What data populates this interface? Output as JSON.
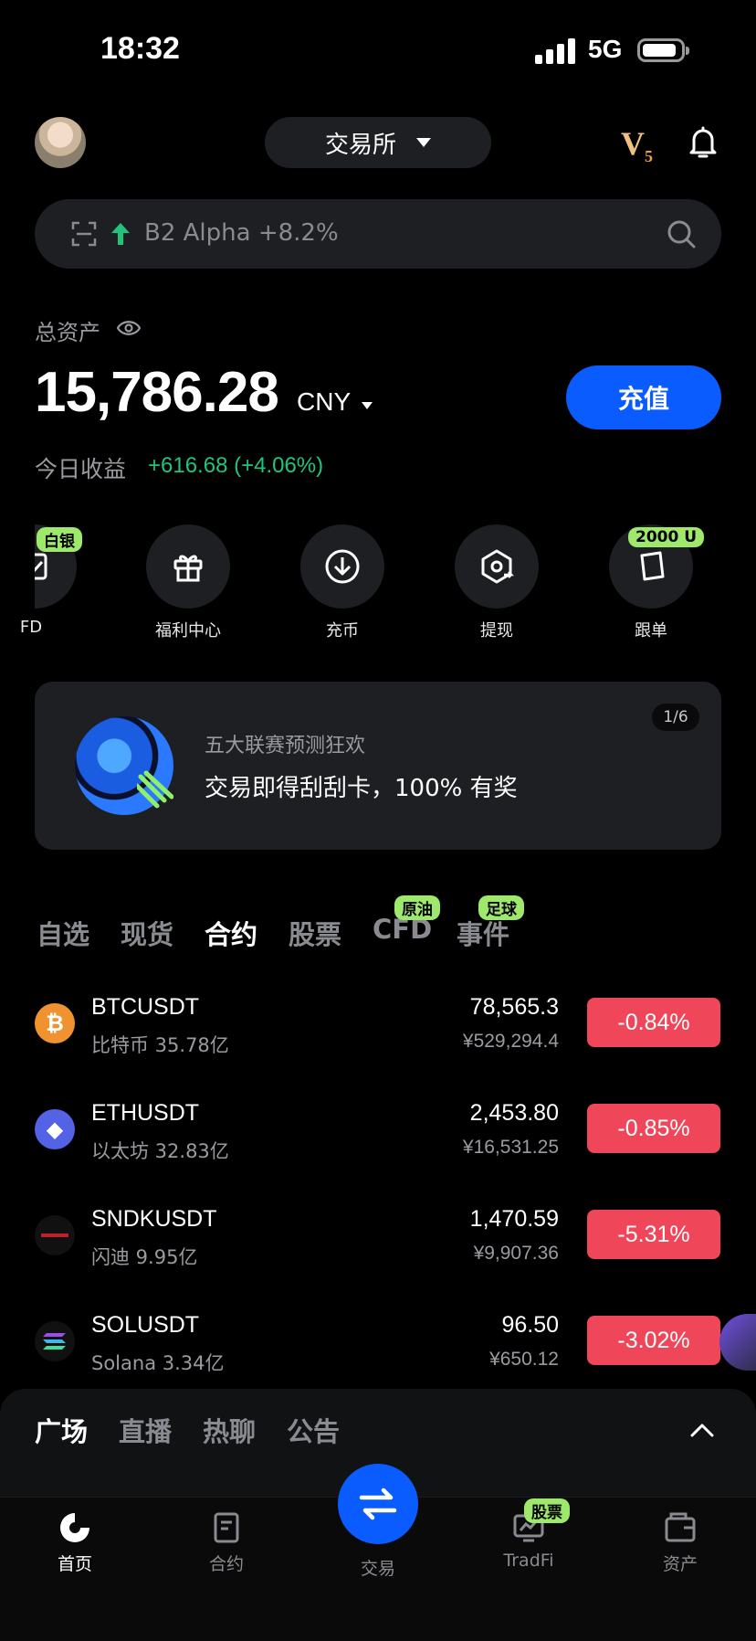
{
  "status": {
    "time": "18:32",
    "network": "5G"
  },
  "header": {
    "exchange_label": "交易所",
    "vip_level": "V",
    "vip_sub": "5"
  },
  "search": {
    "text": "B2 Alpha +8.2%"
  },
  "assets": {
    "label": "总资产",
    "balance": "15,786.28",
    "currency": "CNY",
    "deposit_button": "充值",
    "pnl_label": "今日收益",
    "pnl_value": "+616.68 (+4.06%)"
  },
  "quick_actions": [
    {
      "label": "FD",
      "tag": "白银",
      "icon": "cfd-icon"
    },
    {
      "label": "福利中心",
      "tag": "",
      "icon": "gift-icon"
    },
    {
      "label": "充币",
      "tag": "",
      "icon": "download-icon"
    },
    {
      "label": "提现",
      "tag": "",
      "icon": "withdraw-icon"
    },
    {
      "label": "跟单",
      "tag": "2000 U",
      "icon": "copy-trade-icon"
    }
  ],
  "banner": {
    "subtitle": "五大联赛预测狂欢",
    "title": "交易即得刮刮卡，100% 有奖",
    "pager": "1/6"
  },
  "market_tabs": [
    {
      "label": "自选",
      "tag": ""
    },
    {
      "label": "现货",
      "tag": ""
    },
    {
      "label": "合约",
      "tag": "",
      "active": true
    },
    {
      "label": "股票",
      "tag": ""
    },
    {
      "label": "CFD",
      "tag": "原油"
    },
    {
      "label": "事件",
      "tag": "足球"
    }
  ],
  "market_rows": [
    {
      "symbol": "BTCUSDT",
      "name": "比特币 35.78亿",
      "price": "78,565.3",
      "cny": "¥529,294.4",
      "change": "-0.84%",
      "icon_color": "#f0922f",
      "icon_glyph": "₿"
    },
    {
      "symbol": "ETHUSDT",
      "name": "以太坊 32.83亿",
      "price": "2,453.80",
      "cny": "¥16,531.25",
      "change": "-0.85%",
      "icon_color": "#5462e6",
      "icon_glyph": "◆"
    },
    {
      "symbol": "SNDKUSDT",
      "name": "闪迪 9.95亿",
      "price": "1,470.59",
      "cny": "¥9,907.36",
      "change": "-5.31%",
      "icon_color": "#111111",
      "icon_glyph": ""
    },
    {
      "symbol": "SOLUSDT",
      "name": "Solana 3.34亿",
      "price": "96.50",
      "cny": "¥650.12",
      "change": "-3.02%",
      "icon_color": "#111111",
      "icon_glyph": "≡"
    }
  ],
  "square_tabs": [
    "广场",
    "直播",
    "热聊",
    "公告"
  ],
  "bottom_nav": {
    "home": "首页",
    "contract": "合约",
    "trade": "交易",
    "tradfi": "TradFi",
    "tradfi_tag": "股票",
    "assets": "资产"
  },
  "colors": {
    "accent": "#0a5cff",
    "up": "#21c47a",
    "down": "#f0465a",
    "tag": "#9ee86b"
  }
}
